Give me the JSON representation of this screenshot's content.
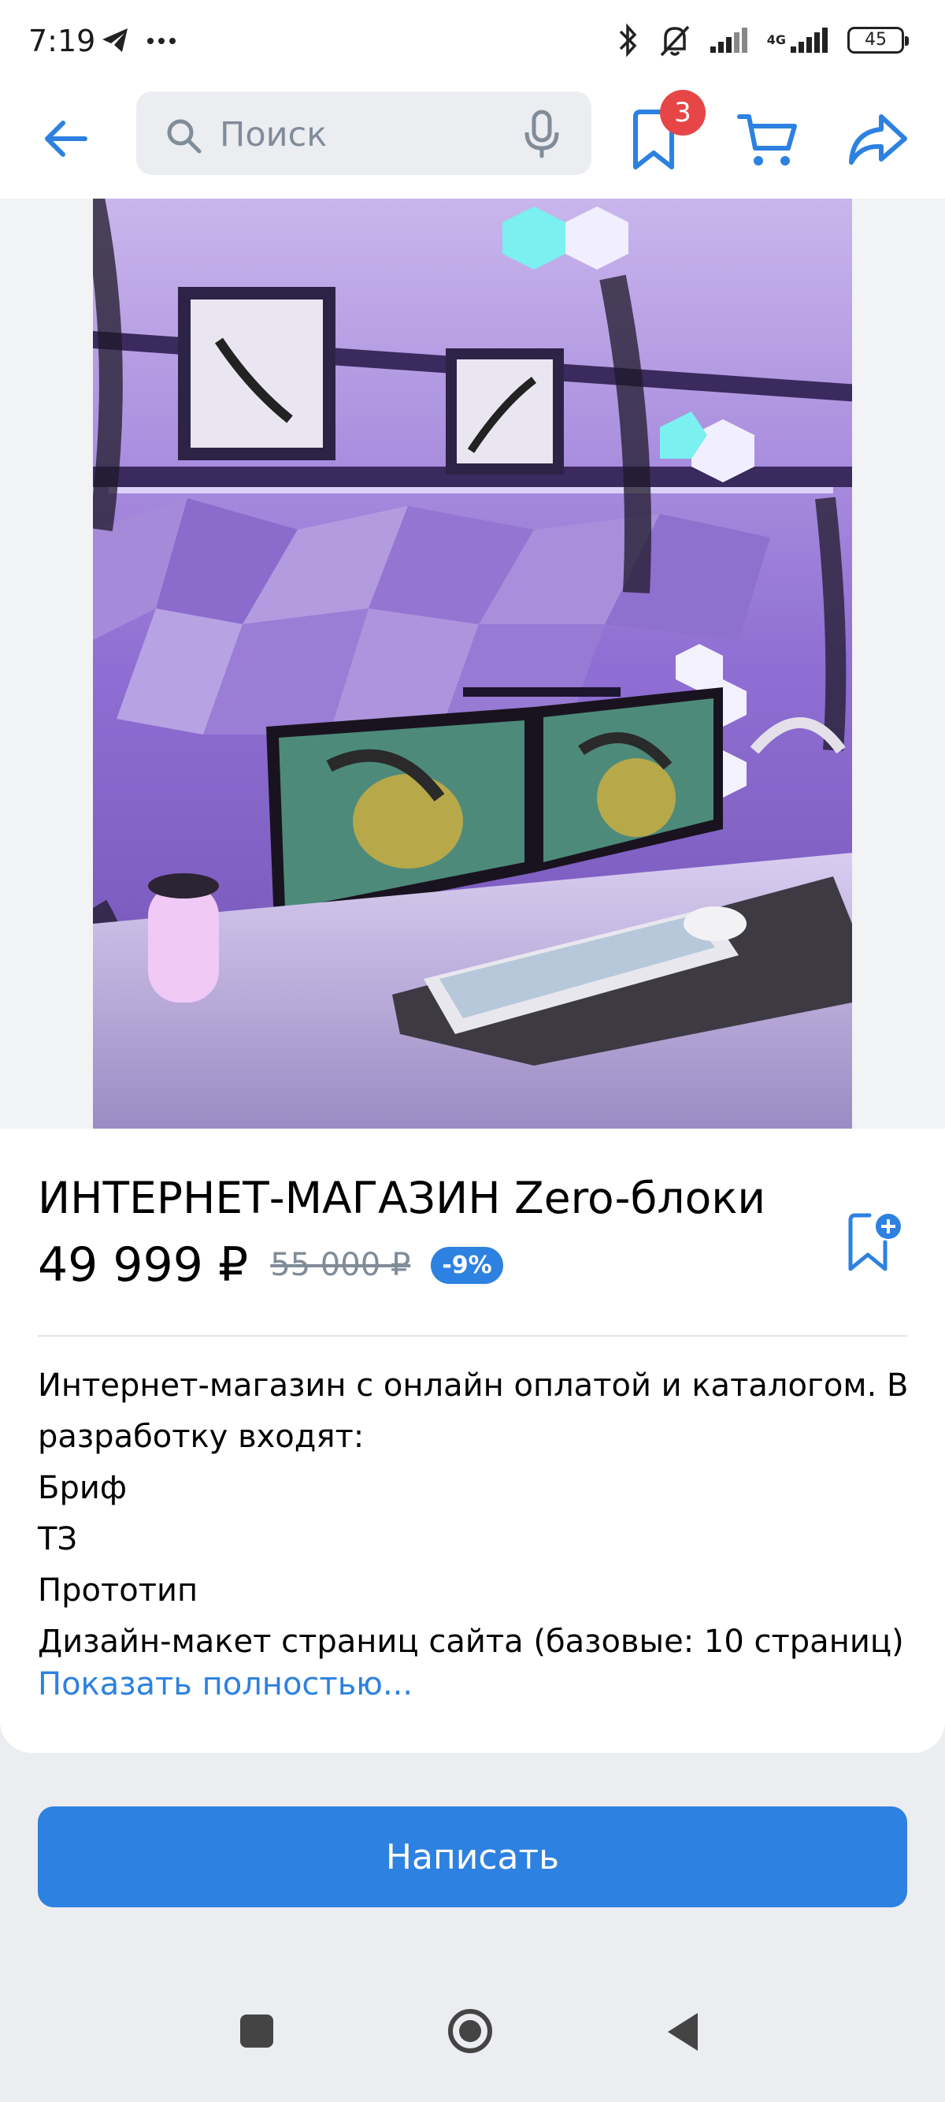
{
  "status_bar": {
    "time": "7:19",
    "network": "4G",
    "battery": "45"
  },
  "search": {
    "placeholder": "Поиск"
  },
  "header": {
    "bookmarks_badge": "3"
  },
  "product": {
    "title": "ИНТЕРНЕТ-МАГАЗИН Zero-блоки",
    "price": "49 999 ₽",
    "old_price": "55 000 ₽",
    "discount": "-9%",
    "description_lines": [
      "Интернет-магазин с онлайн оплатой и каталогом. В разработку входят:",
      "Бриф",
      "ТЗ",
      "Прототип",
      "Дизайн-макет страниц сайта (базовые: 10 страниц)"
    ],
    "show_more": "Показать полностью..."
  },
  "actions": {
    "write_label": "Написать"
  },
  "colors": {
    "accent": "#2d81e0",
    "badge": "#e64646",
    "background": "#ebedf0"
  },
  "icons": [
    "telegram-icon",
    "more-icon",
    "bluetooth-icon",
    "bell-off-icon",
    "signal-icon",
    "battery-icon",
    "back-arrow-icon",
    "search-icon",
    "mic-icon",
    "bookmark-icon",
    "cart-icon",
    "share-icon",
    "bookmark-add-icon",
    "nav-square-icon",
    "nav-home-icon",
    "nav-back-icon"
  ]
}
